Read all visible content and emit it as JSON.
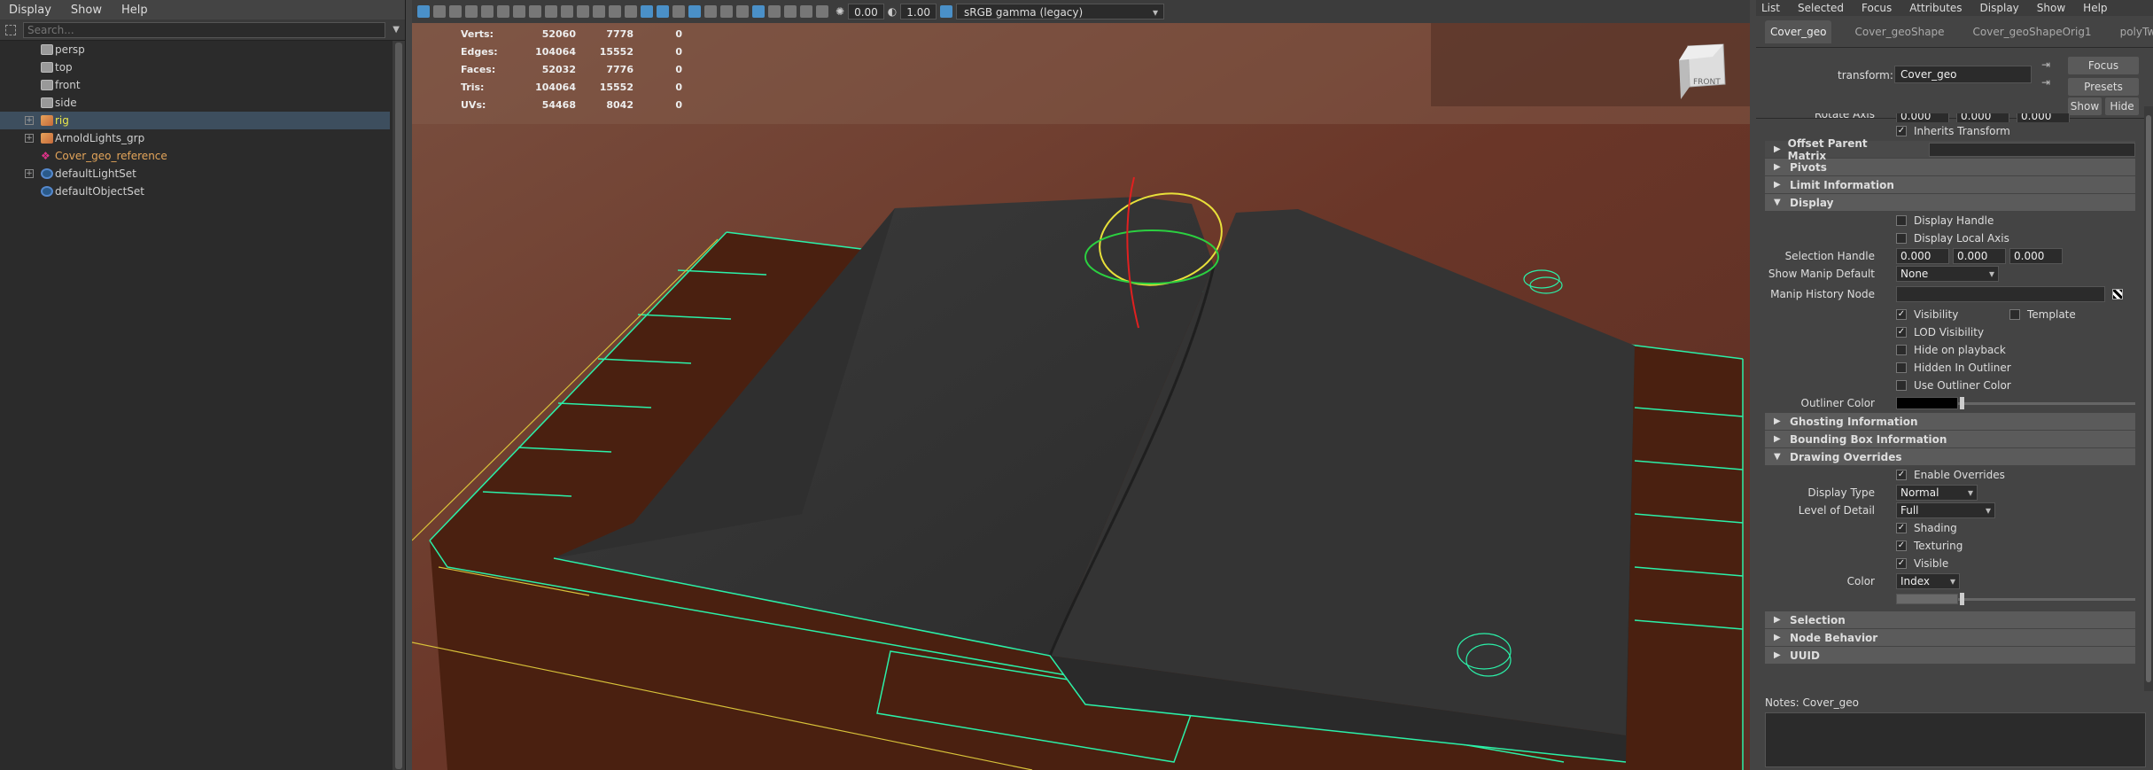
{
  "outliner": {
    "menu": [
      "Display",
      "Show",
      "Help"
    ],
    "search_placeholder": "Search...",
    "items": [
      {
        "label": "persp",
        "icon": "camera-icon",
        "expandable": false
      },
      {
        "label": "top",
        "icon": "camera-icon",
        "expandable": false
      },
      {
        "label": "front",
        "icon": "camera-icon",
        "expandable": false
      },
      {
        "label": "side",
        "icon": "camera-icon",
        "expandable": false
      },
      {
        "label": "rig",
        "icon": "group-icon",
        "expandable": true,
        "selected": true
      },
      {
        "label": "ArnoldLights_grp",
        "icon": "group-icon",
        "expandable": true
      },
      {
        "label": "Cover_geo_reference",
        "icon": "reference-icon",
        "expandable": false
      },
      {
        "label": "defaultLightSet",
        "icon": "set-icon",
        "expandable": true
      },
      {
        "label": "defaultObjectSet",
        "icon": "set-icon",
        "expandable": false
      }
    ]
  },
  "viewport": {
    "exposure": "0.00",
    "gamma": "1.00",
    "colorspace": "sRGB gamma (legacy)",
    "hud": [
      {
        "k": "Verts:",
        "a": "52060",
        "b": "7778",
        "c": "0"
      },
      {
        "k": "Edges:",
        "a": "104064",
        "b": "15552",
        "c": "0"
      },
      {
        "k": "Faces:",
        "a": "52032",
        "b": "7776",
        "c": "0"
      },
      {
        "k": "Tris:",
        "a": "104064",
        "b": "15552",
        "c": "0"
      },
      {
        "k": "UVs:",
        "a": "54468",
        "b": "8042",
        "c": "0"
      }
    ],
    "viewcube_label": "FRONT"
  },
  "ae": {
    "menu": [
      "List",
      "Selected",
      "Focus",
      "Attributes",
      "Display",
      "Show",
      "Help"
    ],
    "tabs": [
      "Cover_geo",
      "Cover_geoShape",
      "Cover_geoShapeOrig1",
      "polyTweakUV"
    ],
    "transform_label": "transform:",
    "transform_value": "Cover_geo",
    "focus": "Focus",
    "presets": "Presets",
    "show": "Show",
    "hide": "Hide",
    "rotate_axis_label": "Rotate Axis",
    "rotate_axis": [
      "0.000",
      "0.000",
      "0.000"
    ],
    "inherits_transform": "Inherits Transform",
    "sections": {
      "offset_parent": "Offset Parent Matrix",
      "pivots": "Pivots",
      "limit": "Limit Information",
      "display": "Display",
      "ghosting": "Ghosting Information",
      "bbox": "Bounding Box Information",
      "drawing": "Drawing Overrides",
      "selection": "Selection",
      "node_behavior": "Node Behavior",
      "uuid": "UUID"
    },
    "display": {
      "display_handle": "Display Handle",
      "display_local_axis": "Display Local Axis",
      "selection_handle_label": "Selection Handle",
      "selection_handle": [
        "0.000",
        "0.000",
        "0.000"
      ],
      "show_manip_label": "Show Manip Default",
      "show_manip_value": "None",
      "manip_history_label": "Manip History Node",
      "visibility": "Visibility",
      "template": "Template",
      "lod_visibility": "LOD Visibility",
      "hide_on_playback": "Hide on playback",
      "hidden_in_outliner": "Hidden In Outliner",
      "use_outliner_color": "Use Outliner Color",
      "outliner_color_label": "Outliner Color"
    },
    "overrides": {
      "enable": "Enable Overrides",
      "display_type_label": "Display Type",
      "display_type": "Normal",
      "lod_label": "Level of Detail",
      "lod": "Full",
      "shading": "Shading",
      "texturing": "Texturing",
      "visible": "Visible",
      "color_label": "Color",
      "color": "Index"
    },
    "notes_label": "Notes:  Cover_geo"
  }
}
